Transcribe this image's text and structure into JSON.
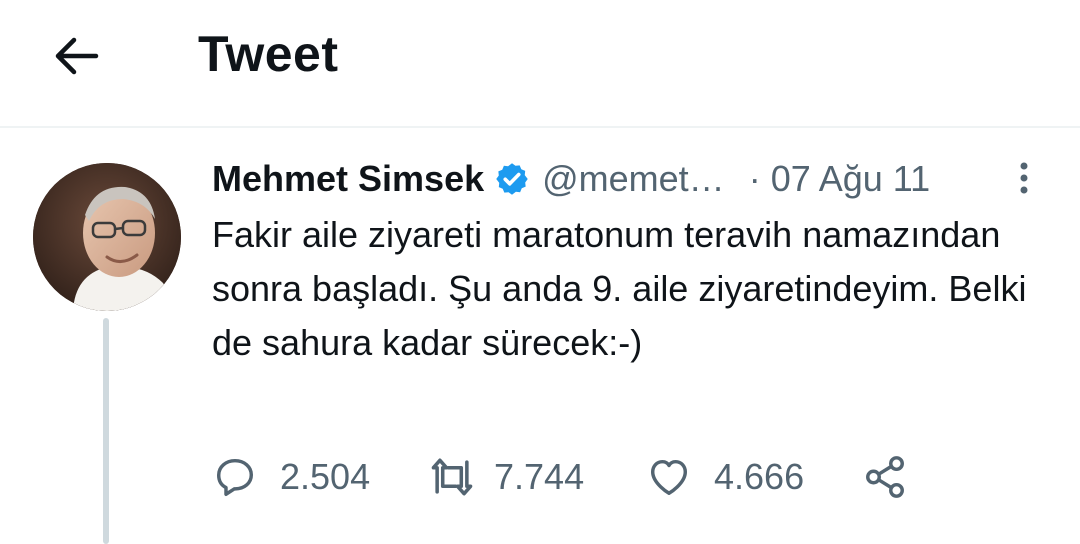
{
  "header": {
    "title": "Tweet",
    "back_icon": "arrow-left-icon"
  },
  "tweet": {
    "author": {
      "name": "Mehmet Simsek",
      "handle": "@memet…",
      "verified": true,
      "verified_color": "#1d9bf0"
    },
    "separator": "·",
    "date": "07 Ağu 11",
    "text": "Fakir aile ziyareti maratonum teravih namazından sonra başladı. Şu anda 9. aile ziyaretindeyim. Belki de sahura kadar sürecek:-)",
    "stats": {
      "replies": "2.504",
      "retweets": "7.744",
      "likes": "4.666"
    }
  },
  "colors": {
    "text_primary": "#0f1419",
    "text_secondary": "#536471",
    "divider": "#eff3f4",
    "thread_line": "#cfd9de"
  }
}
